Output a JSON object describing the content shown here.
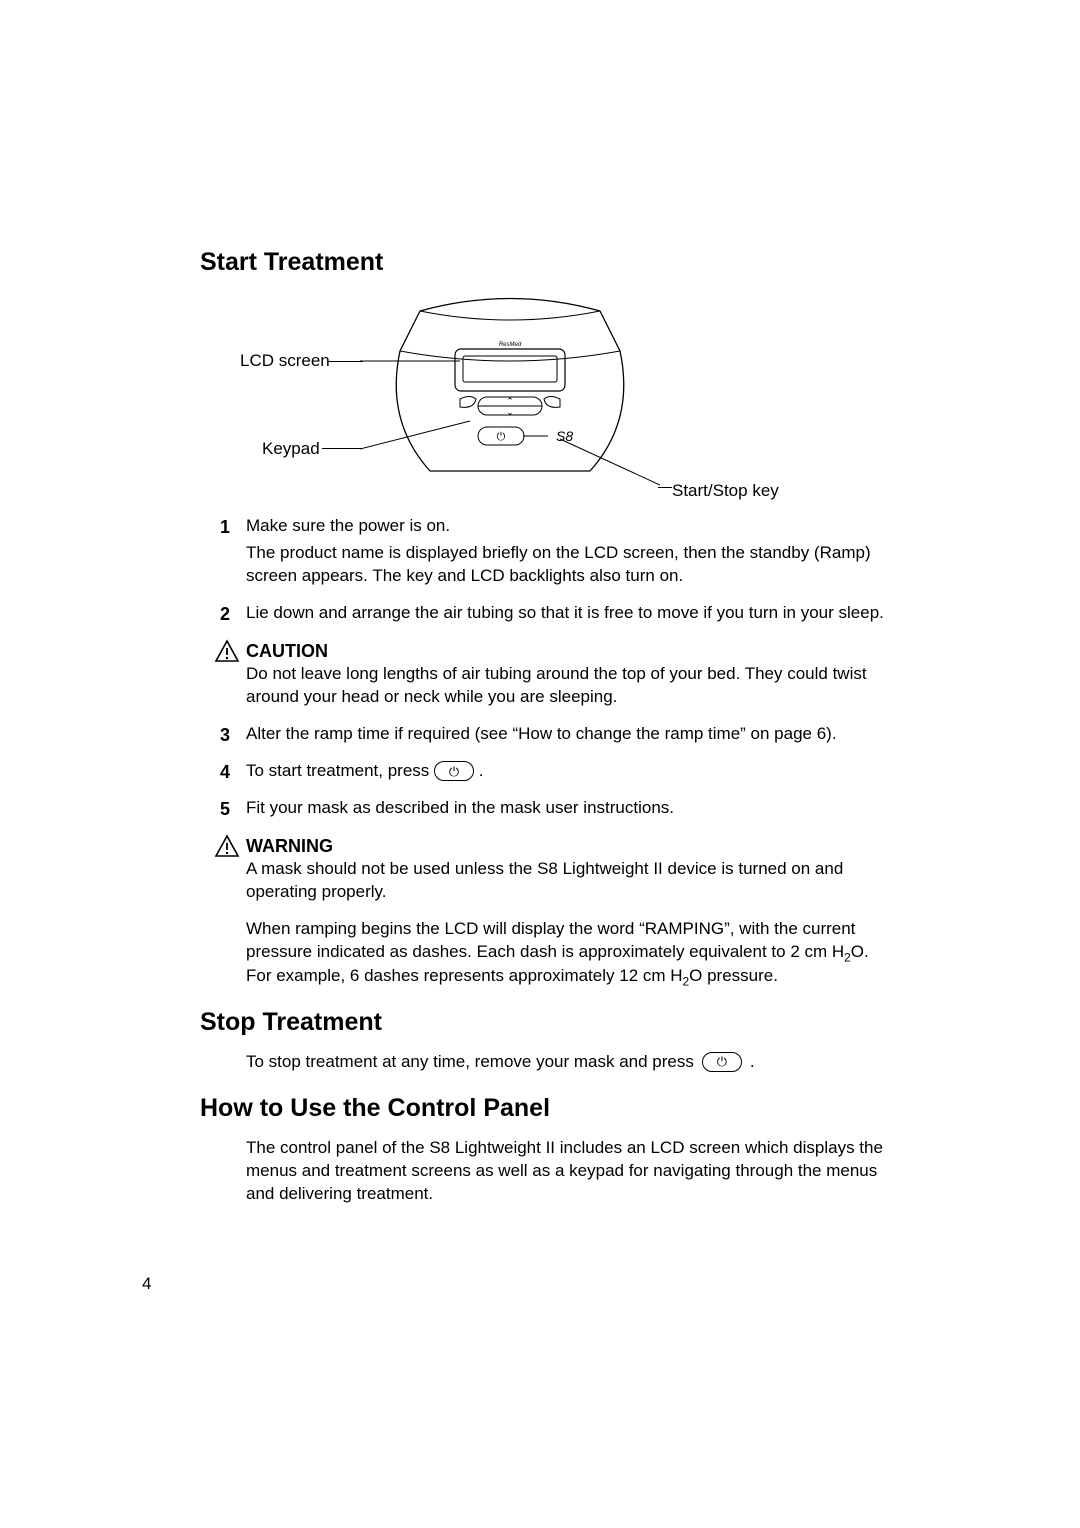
{
  "section_start": "Start Treatment",
  "figure": {
    "lcd_label": "LCD screen",
    "keypad_label": "Keypad",
    "startstop_label": "Start/Stop key",
    "brand": "ResMed",
    "device_label": "S8"
  },
  "steps": {
    "s1_num": "1",
    "s1_lead": "Make sure the power is on.",
    "s1_body": "The product name is displayed briefly on the LCD screen, then the standby (Ramp) screen appears. The key and LCD backlights also turn on.",
    "s2_num": "2",
    "s2_body": "Lie down and arrange the air tubing so that it is free to move if you turn in your sleep.",
    "caution_title": "CAUTION",
    "caution_body": "Do not leave long lengths of air tubing around the top of your bed. They could twist around your head or neck while you are sleeping.",
    "s3_num": "3",
    "s3_body": "Alter the ramp time if required (see “How to change the ramp time” on page 6).",
    "s4_num": "4",
    "s4_pre": "To start treatment, press",
    "s4_post": ".",
    "s5_num": "5",
    "s5_body": "Fit your mask as described in the mask user instructions.",
    "warning_title": "WARNING",
    "warning_body": "A mask should not be used unless the S8 Lightweight II device is turned on and operating properly.",
    "ramp_body_pre": "When ramping begins the LCD will display the word “RAMPING”, with the current pressure indicated as dashes. Each dash is approximately equivalent to 2 cm H",
    "ramp_body_mid": "O. For example, 6 dashes represents approximately 12 cm H",
    "ramp_body_post": "O pressure.",
    "sub2": "2"
  },
  "section_stop": "Stop Treatment",
  "stop_pre": "To stop treatment at any time, remove your mask and press",
  "stop_post": ".",
  "section_ctrl": "How to Use the Control Panel",
  "ctrl_body": "The control panel of the S8 Lightweight II includes an LCD screen which displays the menus and treatment screens as well as a keypad for navigating through the menus and delivering treatment.",
  "page_number": "4",
  "icons": {
    "power": "⏻"
  }
}
